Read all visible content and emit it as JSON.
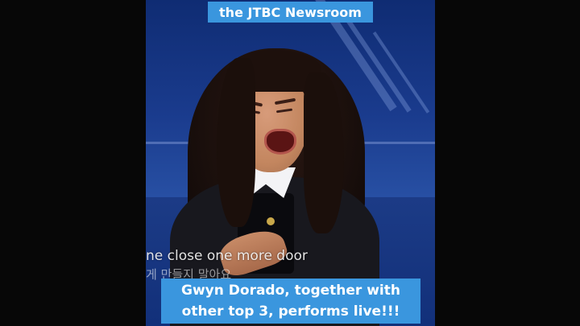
{
  "video": {
    "top_caption": "the JTBC Newsroom",
    "lyric_line": "ne close one more door",
    "lyric_korean": "게 만들지 말아요",
    "bottom_caption_line1": "Gwyn Dorado, together with",
    "bottom_caption_line2": "other top 3, performs live!!!"
  },
  "colors": {
    "caption_bg": "#3a96de",
    "page_bg": "#070707"
  }
}
